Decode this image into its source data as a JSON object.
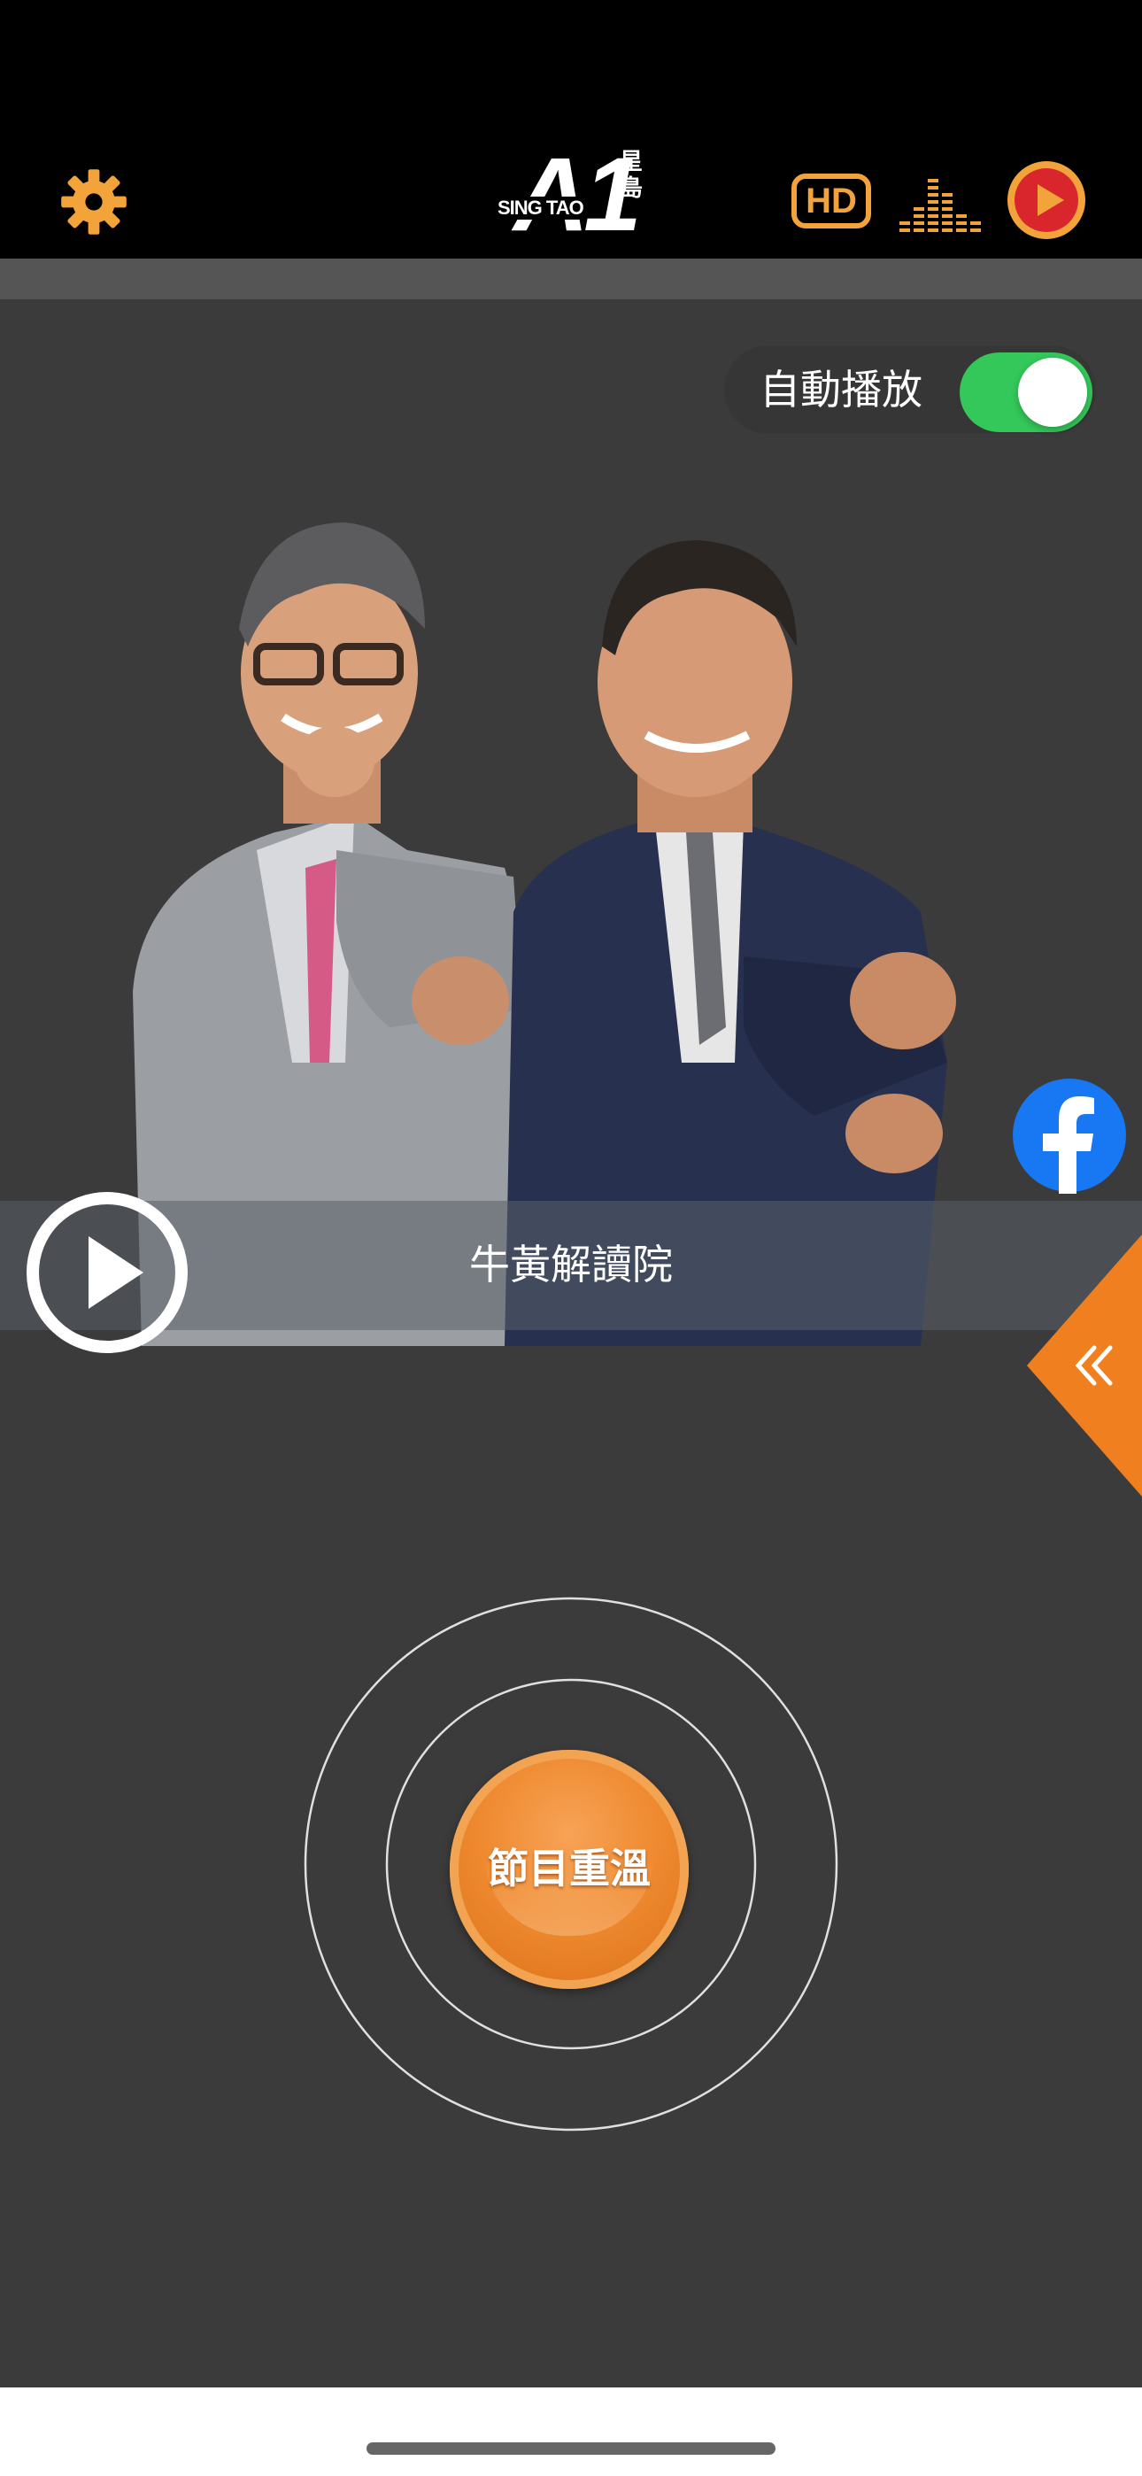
{
  "header": {
    "logo": {
      "main": "A1",
      "brand": "SING TAO",
      "cjk": "星島"
    },
    "hd_label": "HD",
    "icons": {
      "settings": "gear-icon",
      "quality": "hd-icon",
      "equalizer": "equalizer-icon",
      "live": "play-circle-icon"
    }
  },
  "autoplay": {
    "label": "自動播放",
    "enabled": true
  },
  "program": {
    "title": "牛黃解讀院"
  },
  "replay": {
    "label": "節目重溫"
  },
  "colors": {
    "accent": "#f2a33a",
    "toggle_on": "#34c759",
    "background": "#3b3b3b",
    "live_red": "#d8262c",
    "facebook": "#1877f2",
    "drawer": "#f0801f"
  }
}
